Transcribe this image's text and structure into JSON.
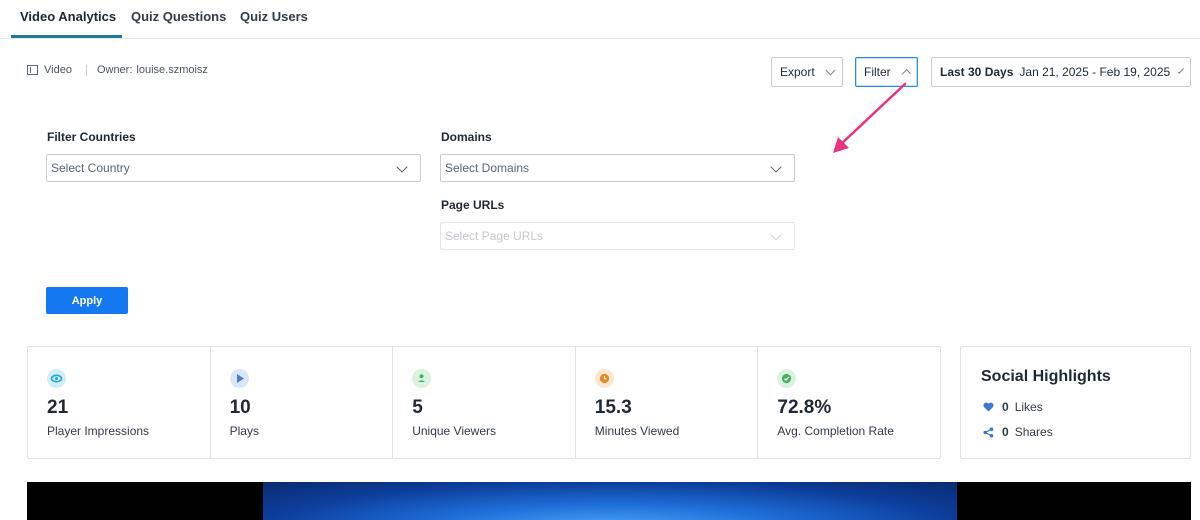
{
  "tabs": [
    {
      "label": "Video Analytics",
      "active": true
    },
    {
      "label": "Quiz Questions",
      "active": false
    },
    {
      "label": "Quiz Users",
      "active": false
    }
  ],
  "meta": {
    "type_icon": "video-icon",
    "type_label": "Video",
    "owner_label": "Owner:",
    "owner_value": "louise.szmoisz"
  },
  "toolbar": {
    "export_label": "Export",
    "filter_label": "Filter",
    "date_preset": "Last 30 Days",
    "date_range": "Jan 21, 2025 - Feb 19, 2025"
  },
  "filters": {
    "countries_label": "Filter Countries",
    "countries_placeholder": "Select Country",
    "domains_label": "Domains",
    "domains_placeholder": "Select Domains",
    "urls_label": "Page URLs",
    "urls_placeholder": "Select Page URLs",
    "apply_label": "Apply"
  },
  "stats": [
    {
      "icon": "eye-icon",
      "color": "#1aa6d6",
      "bg": "#d3eef8",
      "value": "21",
      "label": "Player Impressions"
    },
    {
      "icon": "play-icon",
      "color": "#4a7fd8",
      "bg": "#dbe6f8",
      "value": "10",
      "label": "Plays"
    },
    {
      "icon": "user-icon",
      "color": "#3fb65b",
      "bg": "#dbf2e0",
      "value": "5",
      "label": "Unique Viewers"
    },
    {
      "icon": "clock-icon",
      "color": "#e58a21",
      "bg": "#fbe7cf",
      "value": "15.3",
      "label": "Minutes Viewed"
    },
    {
      "icon": "check-circle-icon",
      "color": "#45b25b",
      "bg": "#dcf1e0",
      "value": "72.8%",
      "label": "Avg. Completion Rate"
    }
  ],
  "social": {
    "title": "Social Highlights",
    "likes_count": "0",
    "likes_label": "Likes",
    "shares_count": "0",
    "shares_label": "Shares"
  },
  "colors": {
    "accent": "#1f7a9c",
    "primary_button": "#1479f0",
    "annotation_arrow": "#e8337f"
  }
}
